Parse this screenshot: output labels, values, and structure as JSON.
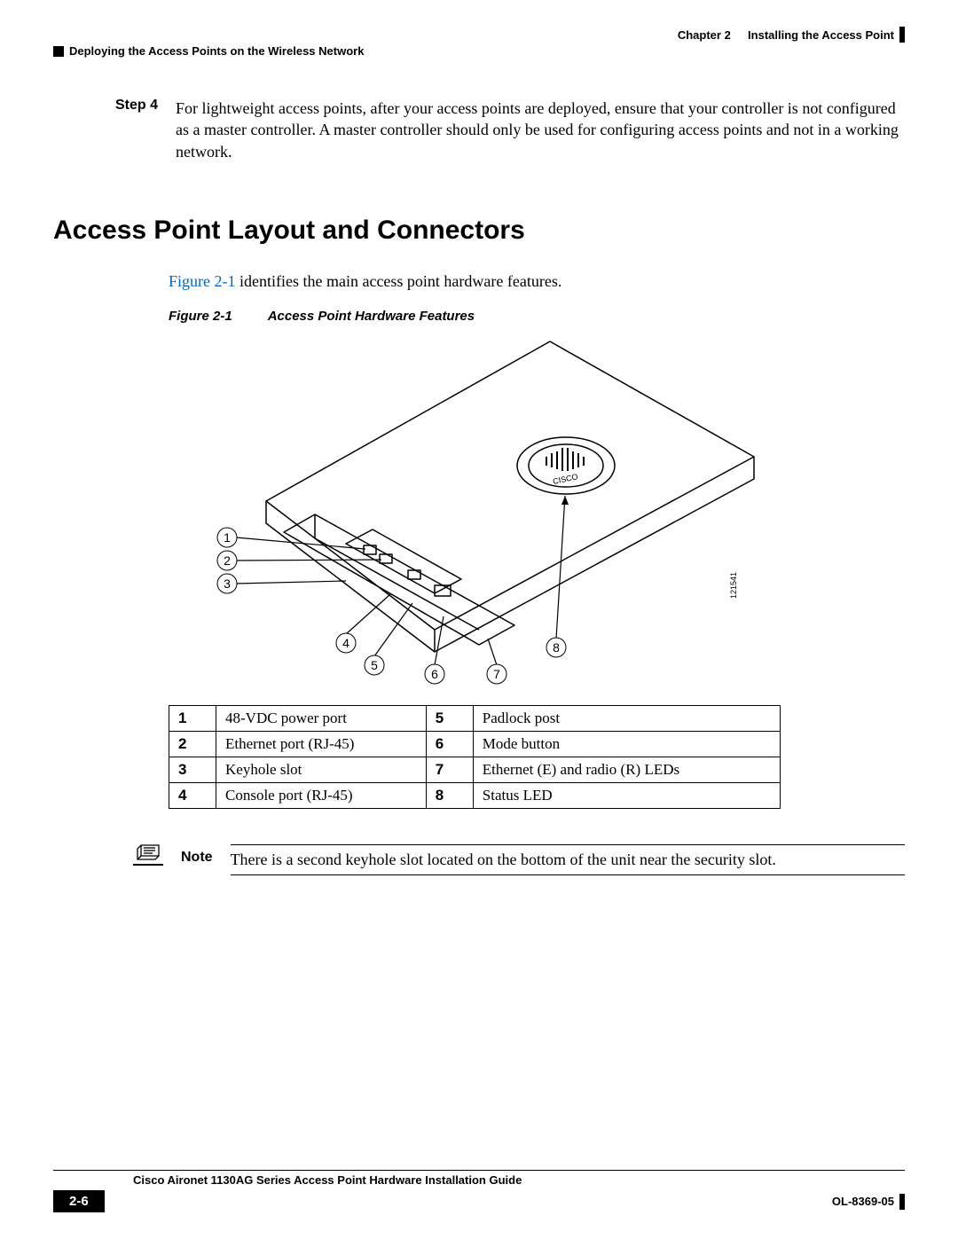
{
  "header": {
    "chapter_label": "Chapter 2",
    "chapter_title": "Installing the Access Point",
    "section_title": "Deploying the Access Points on the Wireless Network"
  },
  "step": {
    "label": "Step 4",
    "text": "For lightweight access points, after your access points are deployed, ensure that your controller is not configured as a master controller. A master controller should only be used for configuring access points and not in a working network."
  },
  "heading": "Access Point Layout and Connectors",
  "intro": {
    "link_text": "Figure 2-1",
    "rest": " identifies the main access point hardware features."
  },
  "figure": {
    "label": "Figure 2-1",
    "title": "Access Point Hardware Features",
    "callouts": [
      "1",
      "2",
      "3",
      "4",
      "5",
      "6",
      "7",
      "8"
    ],
    "image_id": "121541"
  },
  "parts": [
    {
      "n": "1",
      "a": "48-VDC power port",
      "m": "5",
      "b": "Padlock post"
    },
    {
      "n": "2",
      "a": "Ethernet port (RJ-45)",
      "m": "6",
      "b": "Mode button"
    },
    {
      "n": "3",
      "a": "Keyhole slot",
      "m": "7",
      "b": "Ethernet (E) and radio (R) LEDs"
    },
    {
      "n": "4",
      "a": "Console port (RJ-45)",
      "m": "8",
      "b": "Status LED"
    }
  ],
  "note": {
    "label": "Note",
    "text": "There is a second keyhole slot located on the bottom of the unit near the security slot."
  },
  "footer": {
    "guide": "Cisco Aironet 1130AG Series Access Point Hardware Installation Guide",
    "page": "2-6",
    "doc_id": "OL-8369-05"
  }
}
